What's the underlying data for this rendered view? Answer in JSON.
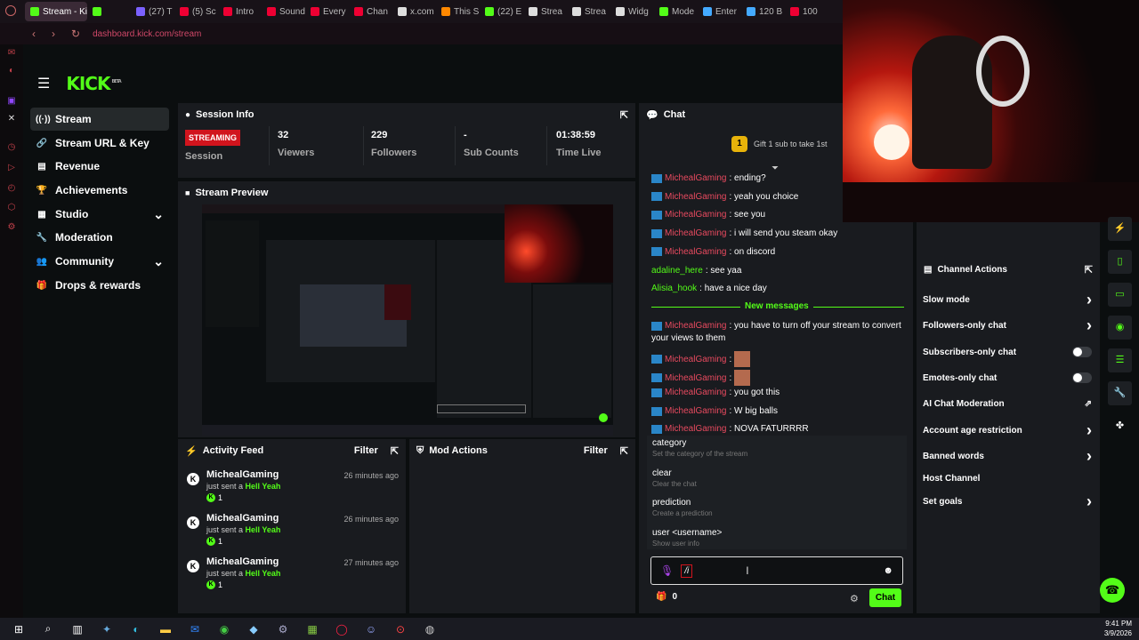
{
  "browser": {
    "tabs": [
      {
        "label": "Stream - Ki",
        "color": "#53fc18",
        "active": true
      },
      {
        "label": "",
        "color": "#53fc18"
      },
      {
        "label": "(27) T",
        "color": "#7b61ff"
      },
      {
        "label": "(5) Sc",
        "color": "#e03"
      },
      {
        "label": "Intro",
        "color": "#e03"
      },
      {
        "label": "Sound",
        "color": "#e03"
      },
      {
        "label": "Every",
        "color": "#e03"
      },
      {
        "label": "Chan",
        "color": "#e03"
      },
      {
        "label": "x.com",
        "color": "#ddd"
      },
      {
        "label": "This S",
        "color": "#f80"
      },
      {
        "label": "(22) E",
        "color": "#53fc18"
      },
      {
        "label": "Strea",
        "color": "#ddd"
      },
      {
        "label": "Strea",
        "color": "#ddd"
      },
      {
        "label": "Widg",
        "color": "#ddd"
      },
      {
        "label": "Mode",
        "color": "#53fc18"
      },
      {
        "label": "Enter",
        "color": "#4af"
      },
      {
        "label": "120 B",
        "color": "#4af"
      },
      {
        "label": "100",
        "color": "#e03"
      }
    ],
    "url": "dashboard.kick.com/stream"
  },
  "header": {
    "logo": "KICK",
    "logo_sup": "BETA"
  },
  "sidebar": {
    "items": [
      {
        "label": "Stream",
        "icon": "stream-icon",
        "glyph": "((·))"
      },
      {
        "label": "Stream URL & Key",
        "icon": "link-icon",
        "glyph": "🔗"
      },
      {
        "label": "Revenue",
        "icon": "revenue-icon",
        "glyph": "▤"
      },
      {
        "label": "Achievements",
        "icon": "trophy-icon",
        "glyph": "🏆"
      },
      {
        "label": "Studio",
        "icon": "studio-icon",
        "glyph": "▦"
      },
      {
        "label": "Moderation",
        "icon": "wrench-icon",
        "glyph": "🔧"
      },
      {
        "label": "Community",
        "icon": "community-icon",
        "glyph": "👥"
      },
      {
        "label": "Drops & rewards",
        "icon": "drops-icon",
        "glyph": "🎁"
      }
    ]
  },
  "session": {
    "title": "Session Info",
    "status": "STREAMING",
    "status_label": "Session",
    "viewers": "32",
    "viewers_label": "Viewers",
    "followers": "229",
    "followers_label": "Followers",
    "subs": "-",
    "subs_label": "Sub Counts",
    "time": "01:38:59",
    "time_label": "Time Live"
  },
  "preview": {
    "title": "Stream Preview"
  },
  "activity": {
    "title": "Activity Feed",
    "filter": "Filter",
    "items": [
      {
        "name": "MichealGaming",
        "time": "26 minutes ago",
        "text": "just sent a",
        "gift": "Hell Yeah",
        "count": "1"
      },
      {
        "name": "MichealGaming",
        "time": "26 minutes ago",
        "text": "just sent a",
        "gift": "Hell Yeah",
        "count": "1"
      },
      {
        "name": "MichealGaming",
        "time": "27 minutes ago",
        "text": "just sent a",
        "gift": "Hell Yeah",
        "count": "1"
      }
    ]
  },
  "mod": {
    "title": "Mod Actions",
    "filter": "Filter"
  },
  "chat": {
    "title": "Chat",
    "gift_rank": "1",
    "gift_text": "Gift 1 sub to take 1st",
    "messages": [
      {
        "user": "MichealGaming",
        "text": ": ending?"
      },
      {
        "user": "MichealGaming",
        "text": ": yeah you choice"
      },
      {
        "user": "MichealGaming",
        "text": ": see you"
      },
      {
        "user": "MichealGaming",
        "text": ": i will send you steam okay"
      },
      {
        "user": "MichealGaming",
        "text": ": on discord"
      },
      {
        "user": "adaline_here",
        "text": ": see yaa"
      },
      {
        "user": "Alisia_hook",
        "text": ": have a nice day"
      }
    ],
    "new_messages": "New messages",
    "messages2": [
      {
        "user": "MichealGaming",
        "text": ": you have to turn off your stream to convert",
        "text2": "your views to them"
      },
      {
        "user": "MichealGaming",
        "text": ":"
      },
      {
        "user": "MichealGaming",
        "text": ":"
      },
      {
        "user": "MichealGaming",
        "text": ": you got this"
      },
      {
        "user": "MichealGaming",
        "text": ": W big balls"
      },
      {
        "user": "MichealGaming",
        "text": ": NOVA FATURRRR"
      }
    ],
    "commands": [
      {
        "cmd": "category",
        "desc": "Set the category of the stream"
      },
      {
        "cmd": "clear",
        "desc": "Clear the chat"
      },
      {
        "cmd": "prediction",
        "desc": "Create a prediction"
      },
      {
        "cmd": "user <username>",
        "desc": "Show user info"
      }
    ],
    "input_value": "/i",
    "points": "0",
    "send": "Chat"
  },
  "channel_actions": {
    "title": "Channel Actions",
    "items": [
      {
        "label": "Slow mode",
        "kind": "arrow"
      },
      {
        "label": "Followers-only chat",
        "kind": "arrow"
      },
      {
        "label": "Subscribers-only chat",
        "kind": "toggle"
      },
      {
        "label": "Emotes-only chat",
        "kind": "toggle"
      },
      {
        "label": "AI Chat Moderation",
        "kind": "external"
      },
      {
        "label": "Account age restriction",
        "kind": "arrow"
      },
      {
        "label": "Banned words",
        "kind": "arrow"
      },
      {
        "label": "Host Channel",
        "kind": "none"
      },
      {
        "label": "Set goals",
        "kind": "arrow"
      }
    ]
  },
  "taskbar": {
    "time": "9:41 PM",
    "date": "3/9/2026"
  },
  "colors": {
    "accent": "#53fc18",
    "live": "#d1141d",
    "username": "#e84a5f"
  }
}
